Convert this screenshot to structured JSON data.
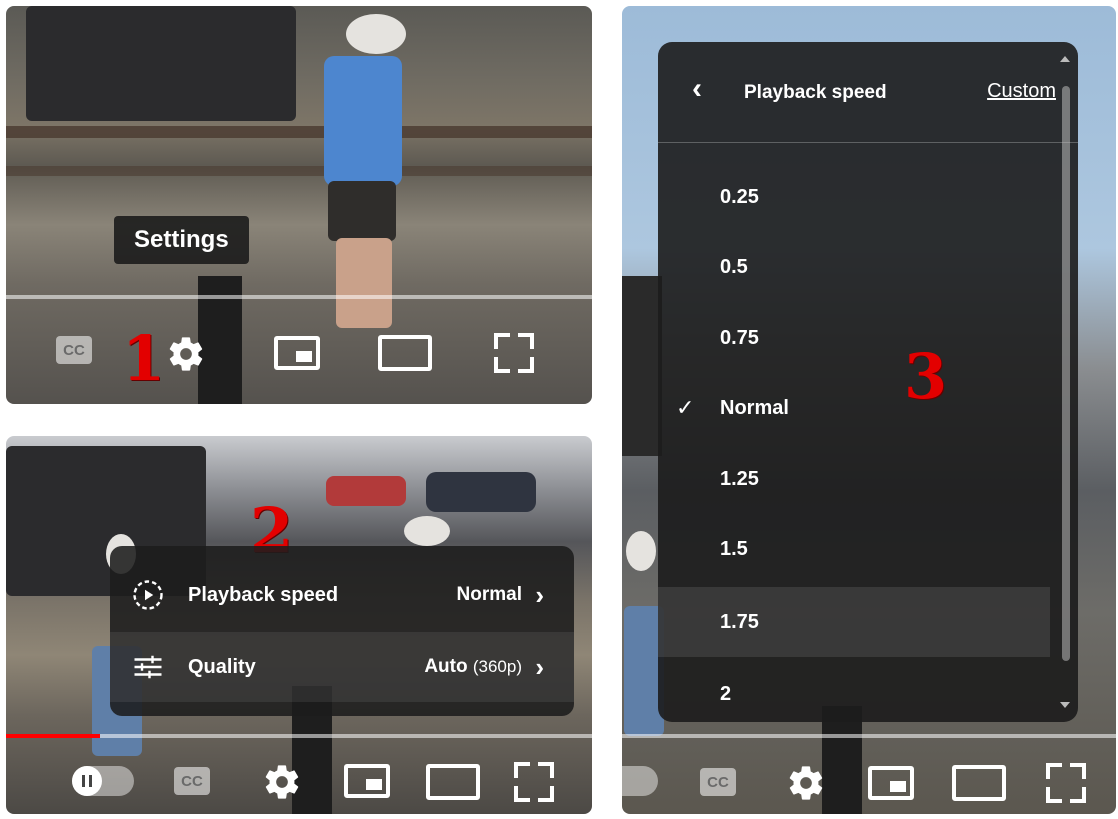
{
  "panel1": {
    "step_number": "1",
    "tooltip": "Settings",
    "controls": {
      "cc_label": "CC"
    }
  },
  "panel2": {
    "step_number": "2",
    "menu": {
      "items": [
        {
          "label": "Playback speed",
          "value": "Normal",
          "value_sub": "",
          "icon": "playback-speed-icon"
        },
        {
          "label": "Quality",
          "value": "Auto",
          "value_sub": "(360p)",
          "icon": "quality-sliders-icon"
        }
      ]
    },
    "controls": {
      "cc_label": "CC"
    },
    "progress": {
      "played_fraction": 0.16
    }
  },
  "panel3": {
    "step_number": "3",
    "playback_menu": {
      "title": "Playback speed",
      "custom_link": "Custom",
      "options": [
        "0.25",
        "0.5",
        "0.75",
        "Normal",
        "1.25",
        "1.5",
        "1.75",
        "2"
      ],
      "selected": "Normal",
      "hovered": "1.75"
    },
    "controls": {
      "cc_label": "CC"
    }
  },
  "colors": {
    "accent_red": "#e30000",
    "progress_red": "#ff0000",
    "menu_bg": "#1c1c1c"
  }
}
